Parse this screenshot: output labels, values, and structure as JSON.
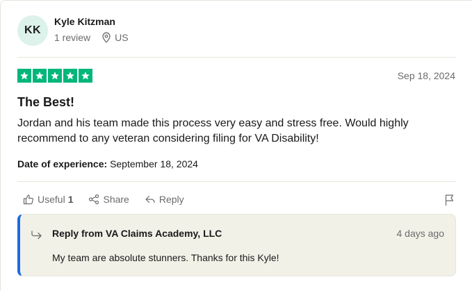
{
  "reviewer": {
    "initials": "KK",
    "name": "Kyle Kitzman",
    "review_count": "1 review",
    "country": "US"
  },
  "review": {
    "rating": 5,
    "date": "Sep 18, 2024",
    "title": "The Best!",
    "body": "Jordan and his team made this process very easy and stress free. Would highly recommend to any veteran considering filing for VA Disability!",
    "experience_label": "Date of experience:",
    "experience_date": "September 18, 2024"
  },
  "actions": {
    "useful_label": "Useful",
    "useful_count": "1",
    "share_label": "Share",
    "reply_label": "Reply"
  },
  "reply": {
    "heading": "Reply from VA Claims Academy, LLC",
    "date": "4 days ago",
    "body": "My team are absolute stunners. Thanks for this Kyle!"
  },
  "icons": {
    "location": "location-pin-icon",
    "star": "star-icon",
    "useful": "thumbs-up-icon",
    "share": "share-icon",
    "reply": "reply-arrow-icon",
    "flag": "flag-icon",
    "company_reply": "company-reply-arrow-icon"
  },
  "colors": {
    "star_green": "#00b67a",
    "avatar_bg": "#dcf2eb",
    "reply_bg": "#f1f1e8",
    "reply_accent": "#1c6ae4"
  }
}
